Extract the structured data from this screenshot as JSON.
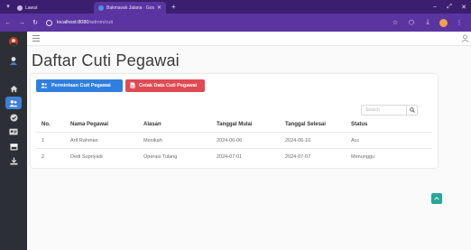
{
  "browser": {
    "tabs": [
      {
        "title": "Lawat",
        "favicon_color": "#c7b6e8"
      },
      {
        "title": "Bakmavak Jalana · Google Dri",
        "favicon_color": "#4a90e2"
      }
    ],
    "url_host": "localhost:8080",
    "url_path": "/admin/cuti"
  },
  "sidebar": {
    "items": [
      {
        "name": "avatar-icon",
        "active": false
      },
      {
        "name": "person-icon",
        "active": false
      },
      {
        "name": "home-icon",
        "active": false
      },
      {
        "name": "users-icon",
        "active": true
      },
      {
        "name": "circle-check-icon",
        "active": false
      },
      {
        "name": "id-card-icon",
        "active": false
      },
      {
        "name": "calendar-icon",
        "active": false
      },
      {
        "name": "download-icon",
        "active": false
      }
    ]
  },
  "page": {
    "title": "Daftar Cuti Pegawai",
    "buttons": {
      "add_label": "Permintaan Cuti Pegawai",
      "print_label": "Cetak Data Cuti Pegawai"
    },
    "search": {
      "placeholder": "Search"
    },
    "table": {
      "headers": [
        "No.",
        "Nama Pegawai",
        "Alasan",
        "Tanggal Mulai",
        "Tanggal Selesai",
        "Status"
      ],
      "rows": [
        [
          "1",
          "Arif Rahman",
          "Menikah",
          "2024-06-06",
          "2024-06-10",
          "Acc"
        ],
        [
          "2",
          "Dedi Supriyadi",
          "Operasi Tulang",
          "2024-07-01",
          "2024-07-07",
          "Menunggu"
        ]
      ]
    }
  },
  "colors": {
    "primary": "#2f7fe0",
    "danger": "#e04a52",
    "teal": "#26a69a",
    "browser_purple": "#5a34a0"
  }
}
